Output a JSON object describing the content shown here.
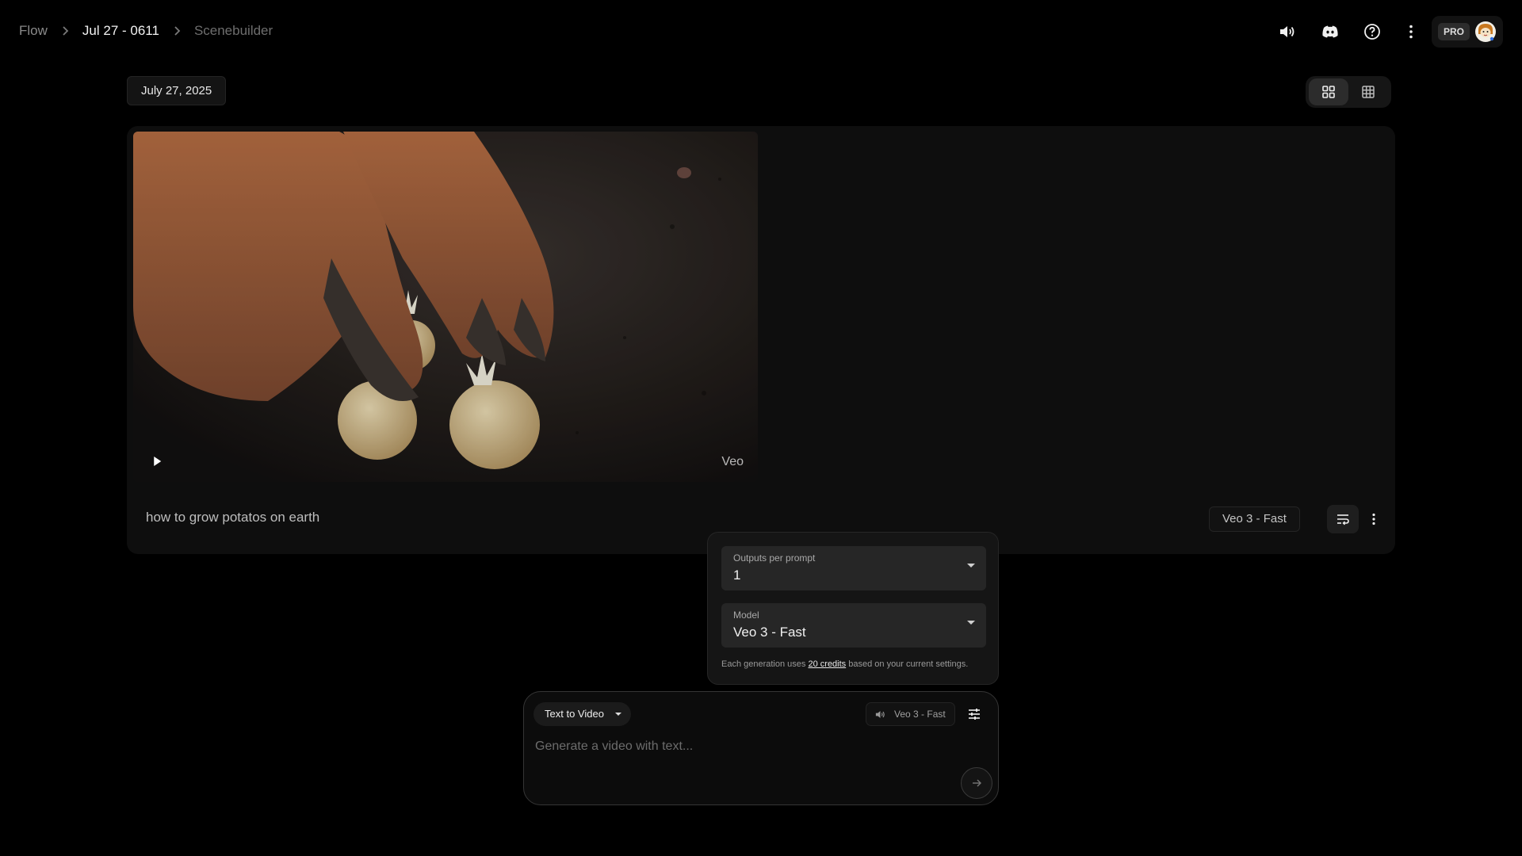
{
  "breadcrumb": {
    "items": [
      {
        "label": "Flow"
      },
      {
        "label": "Jul 27 - 0611"
      },
      {
        "label": "Scenebuilder"
      }
    ]
  },
  "header": {
    "icons": [
      "volume-icon",
      "discord-icon",
      "help-icon",
      "more-vert-icon"
    ],
    "pro_label": "PRO"
  },
  "date_chip": "July 27, 2025",
  "view_toggle": {
    "options": [
      "grid-large-icon",
      "grid-small-icon"
    ],
    "active": 0
  },
  "result": {
    "prompt": "how to grow potatos on earth",
    "watermark": "Veo",
    "model": "Veo 3 - Fast"
  },
  "settings": {
    "outputs_label": "Outputs per prompt",
    "outputs_value": "1",
    "model_label": "Model",
    "model_value": "Veo 3 - Fast",
    "note_prefix": "Each generation uses",
    "note_link": "20 credits",
    "note_suffix": "based on your current settings."
  },
  "composer": {
    "mode": "Text to Video",
    "model": "Veo 3 - Fast",
    "placeholder": "Generate a video with text..."
  },
  "colors": {
    "background": "#000000",
    "card": "#0e0e0e",
    "field": "#262626"
  }
}
